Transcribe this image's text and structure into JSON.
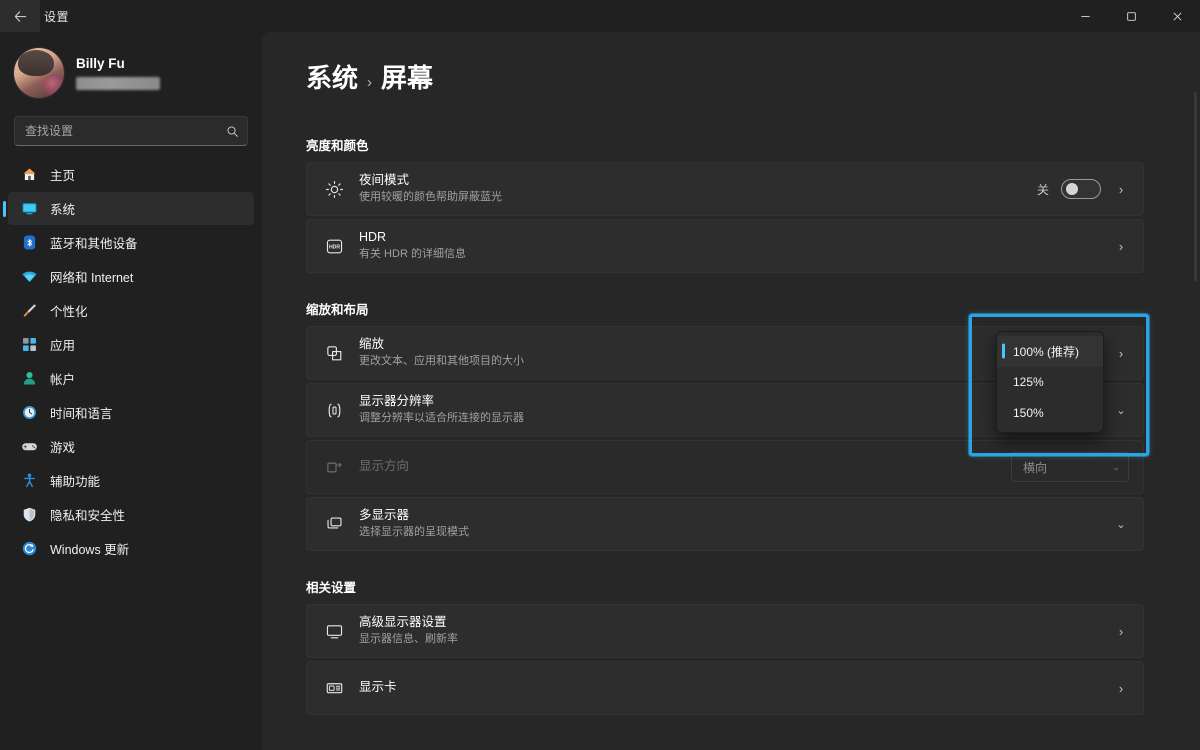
{
  "window": {
    "title": "设置",
    "back_icon": "back-arrow-icon",
    "minimize_label": "–",
    "maximize_label": "❐",
    "close_label": "✕"
  },
  "account": {
    "name": "Billy Fu",
    "email_redacted": ""
  },
  "search": {
    "placeholder": "查找设置",
    "value": "",
    "icon": "search-icon"
  },
  "sidebar": {
    "items": [
      {
        "label": "主页",
        "icon": "home-icon",
        "active": false
      },
      {
        "label": "系统",
        "icon": "system-display-icon",
        "active": true
      },
      {
        "label": "蓝牙和其他设备",
        "icon": "bluetooth-icon",
        "active": false
      },
      {
        "label": "网络和 Internet",
        "icon": "wifi-icon",
        "active": false
      },
      {
        "label": "个性化",
        "icon": "paintbrush-icon",
        "active": false
      },
      {
        "label": "应用",
        "icon": "apps-icon",
        "active": false
      },
      {
        "label": "帐户",
        "icon": "account-icon",
        "active": false
      },
      {
        "label": "时间和语言",
        "icon": "clock-language-icon",
        "active": false
      },
      {
        "label": "游戏",
        "icon": "gamepad-icon",
        "active": false
      },
      {
        "label": "辅助功能",
        "icon": "accessibility-icon",
        "active": false
      },
      {
        "label": "隐私和安全性",
        "icon": "shield-icon",
        "active": false
      },
      {
        "label": "Windows 更新",
        "icon": "update-refresh-icon",
        "active": false
      }
    ]
  },
  "breadcrumb": {
    "parent": "系统",
    "separator": "›",
    "current": "屏幕"
  },
  "sections": [
    {
      "title": "亮度和颜色",
      "rows": [
        {
          "title": "夜间模式",
          "subtitle": "使用较暖的颜色帮助屏蔽蓝光",
          "icon": "brightness-sun-icon",
          "toggle_state": "关",
          "toggle_on": false,
          "chevron": "›"
        },
        {
          "title": "HDR",
          "subtitle": "有关 HDR 的详细信息",
          "icon": "hdr-icon",
          "chevron": "›"
        }
      ]
    },
    {
      "title": "缩放和布局",
      "rows": [
        {
          "title": "缩放",
          "subtitle": "更改文本、应用和其他项目的大小",
          "icon": "scaling-icon",
          "chevron": "›"
        },
        {
          "title": "显示器分辨率",
          "subtitle": "调整分辨率以适合所连接的显示器",
          "icon": "resolution-icon",
          "chevron": "⌄"
        },
        {
          "title": "显示方向",
          "subtitle": "",
          "icon": "orientation-icon",
          "disabled": true,
          "combo_value": "横向",
          "combo_arrow": "⌄"
        },
        {
          "title": "多显示器",
          "subtitle": "选择显示器的呈现模式",
          "icon": "multi-display-icon",
          "chevron": "⌄"
        }
      ]
    },
    {
      "title": "相关设置",
      "rows": [
        {
          "title": "高级显示器设置",
          "subtitle": "显示器信息、刷新率",
          "icon": "monitor-icon",
          "chevron": "›"
        },
        {
          "title": "显示卡",
          "subtitle": "",
          "icon": "graphics-card-icon",
          "chevron": "›"
        }
      ]
    }
  ],
  "scaling_dropdown": {
    "open": true,
    "options": [
      {
        "label": "100% (推荐)",
        "selected": true
      },
      {
        "label": "125%",
        "selected": false
      },
      {
        "label": "150%",
        "selected": false
      }
    ]
  },
  "colors": {
    "accent": "#4cc2ff",
    "highlight_box": "#27a5e8",
    "window_bg": "#202020",
    "content_bg": "#272727",
    "card_bg": "#2d2d2d"
  }
}
